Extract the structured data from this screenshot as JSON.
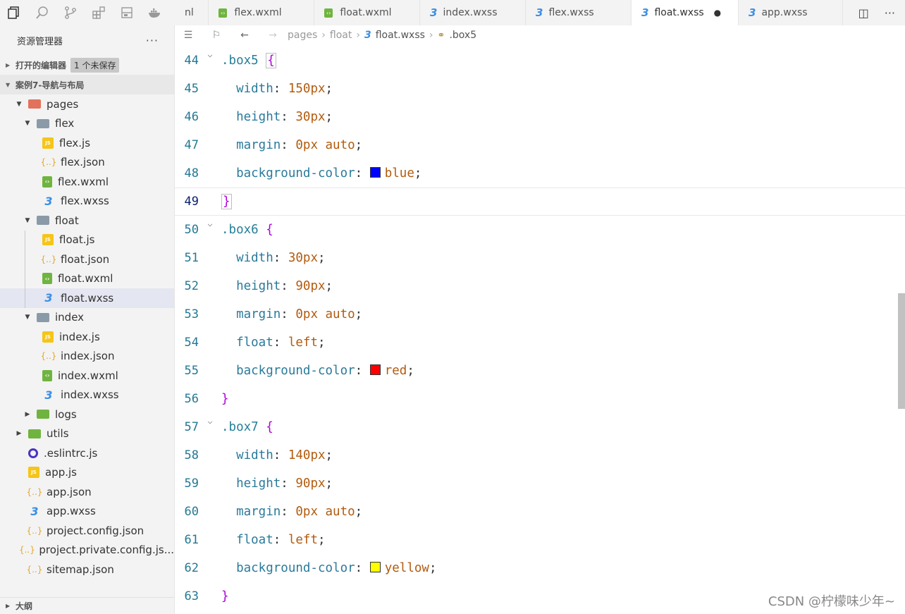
{
  "activity_bar": [
    "explorer-icon",
    "search-icon",
    "source-control-icon",
    "extensions-icon",
    "storage-icon",
    "docker-icon"
  ],
  "sidebar": {
    "title": "资源管理器",
    "more": "···",
    "open_editors": {
      "label": "打开的编辑器",
      "badge": "1 个未保存"
    },
    "project": {
      "label": "案例7-导航与布局"
    },
    "tree": [
      {
        "label": "pages",
        "type": "folder-pages",
        "depth": 1,
        "expanded": true
      },
      {
        "label": "flex",
        "type": "folder",
        "depth": 2,
        "expanded": true
      },
      {
        "label": "flex.js",
        "type": "js",
        "depth": 3
      },
      {
        "label": "flex.json",
        "type": "json",
        "depth": 3
      },
      {
        "label": "flex.wxml",
        "type": "wxml",
        "depth": 3
      },
      {
        "label": "flex.wxss",
        "type": "wxss",
        "depth": 3
      },
      {
        "label": "float",
        "type": "folder",
        "depth": 2,
        "expanded": true
      },
      {
        "label": "float.js",
        "type": "js",
        "depth": 3
      },
      {
        "label": "float.json",
        "type": "json",
        "depth": 3
      },
      {
        "label": "float.wxml",
        "type": "wxml",
        "depth": 3
      },
      {
        "label": "float.wxss",
        "type": "wxss",
        "depth": 3,
        "selected": true
      },
      {
        "label": "index",
        "type": "folder",
        "depth": 2,
        "expanded": true
      },
      {
        "label": "index.js",
        "type": "js",
        "depth": 3
      },
      {
        "label": "index.json",
        "type": "json",
        "depth": 3
      },
      {
        "label": "index.wxml",
        "type": "wxml",
        "depth": 3
      },
      {
        "label": "index.wxss",
        "type": "wxss",
        "depth": 3
      },
      {
        "label": "logs",
        "type": "folder-green",
        "depth": 2,
        "expanded": false
      },
      {
        "label": "utils",
        "type": "folder-green",
        "depth": 1,
        "expanded": false
      },
      {
        "label": ".eslintrc.js",
        "type": "eslint",
        "depth": 1
      },
      {
        "label": "app.js",
        "type": "js",
        "depth": 1
      },
      {
        "label": "app.json",
        "type": "json",
        "depth": 1
      },
      {
        "label": "app.wxss",
        "type": "wxss",
        "depth": 1
      },
      {
        "label": "project.config.json",
        "type": "json",
        "depth": 1
      },
      {
        "label": "project.private.config.js...",
        "type": "json",
        "depth": 1
      },
      {
        "label": "sitemap.json",
        "type": "json",
        "depth": 1
      }
    ],
    "outline": "大纲"
  },
  "tabs": [
    {
      "label": "nl",
      "type": "partial"
    },
    {
      "label": "flex.wxml",
      "type": "wxml"
    },
    {
      "label": "float.wxml",
      "type": "wxml"
    },
    {
      "label": "index.wxss",
      "type": "wxss"
    },
    {
      "label": "flex.wxss",
      "type": "wxss"
    },
    {
      "label": "float.wxss",
      "type": "wxss",
      "active": true,
      "unsaved": "●"
    },
    {
      "label": "app.wxss",
      "type": "wxss"
    }
  ],
  "breadcrumb": [
    "pages",
    "float",
    "float.wxss",
    ".box5"
  ],
  "editor": {
    "current_line": 49,
    "lines": [
      {
        "n": "44",
        "fold": true,
        "tokens": [
          [
            "sel",
            ".box5"
          ],
          [
            "punc",
            " "
          ],
          [
            "brace-box",
            "{"
          ]
        ]
      },
      {
        "n": "45",
        "tokens": [
          [
            "punc",
            "  "
          ],
          [
            "prop",
            "width"
          ],
          [
            "punc",
            ": "
          ],
          [
            "val",
            "150px"
          ],
          [
            "punc",
            ";"
          ]
        ]
      },
      {
        "n": "46",
        "tokens": [
          [
            "punc",
            "  "
          ],
          [
            "prop",
            "height"
          ],
          [
            "punc",
            ": "
          ],
          [
            "val",
            "30px"
          ],
          [
            "punc",
            ";"
          ]
        ]
      },
      {
        "n": "47",
        "tokens": [
          [
            "punc",
            "  "
          ],
          [
            "prop",
            "margin"
          ],
          [
            "punc",
            ": "
          ],
          [
            "val",
            "0px auto"
          ],
          [
            "punc",
            ";"
          ]
        ]
      },
      {
        "n": "48",
        "tokens": [
          [
            "punc",
            "  "
          ],
          [
            "prop",
            "background-color"
          ],
          [
            "punc",
            ": "
          ],
          [
            "swatch",
            "#0000ff"
          ],
          [
            "val",
            "blue"
          ],
          [
            "punc",
            ";"
          ]
        ]
      },
      {
        "n": "49",
        "tokens": [
          [
            "brace-box",
            "}"
          ]
        ]
      },
      {
        "n": "50",
        "fold": true,
        "tokens": [
          [
            "sel",
            ".box6"
          ],
          [
            "punc",
            " "
          ],
          [
            "brace",
            "{"
          ]
        ]
      },
      {
        "n": "51",
        "tokens": [
          [
            "punc",
            "  "
          ],
          [
            "prop",
            "width"
          ],
          [
            "punc",
            ": "
          ],
          [
            "val",
            "30px"
          ],
          [
            "punc",
            ";"
          ]
        ]
      },
      {
        "n": "52",
        "tokens": [
          [
            "punc",
            "  "
          ],
          [
            "prop",
            "height"
          ],
          [
            "punc",
            ": "
          ],
          [
            "val",
            "90px"
          ],
          [
            "punc",
            ";"
          ]
        ]
      },
      {
        "n": "53",
        "tokens": [
          [
            "punc",
            "  "
          ],
          [
            "prop",
            "margin"
          ],
          [
            "punc",
            ": "
          ],
          [
            "val",
            "0px auto"
          ],
          [
            "punc",
            ";"
          ]
        ]
      },
      {
        "n": "54",
        "tokens": [
          [
            "punc",
            "  "
          ],
          [
            "prop",
            "float"
          ],
          [
            "punc",
            ": "
          ],
          [
            "val",
            "left"
          ],
          [
            "punc",
            ";"
          ]
        ]
      },
      {
        "n": "55",
        "tokens": [
          [
            "punc",
            "  "
          ],
          [
            "prop",
            "background-color"
          ],
          [
            "punc",
            ": "
          ],
          [
            "swatch",
            "#ff0000"
          ],
          [
            "val",
            "red"
          ],
          [
            "punc",
            ";"
          ]
        ]
      },
      {
        "n": "56",
        "tokens": [
          [
            "brace",
            "}"
          ]
        ]
      },
      {
        "n": "57",
        "fold": true,
        "tokens": [
          [
            "sel",
            ".box7"
          ],
          [
            "punc",
            " "
          ],
          [
            "brace",
            "{"
          ]
        ]
      },
      {
        "n": "58",
        "tokens": [
          [
            "punc",
            "  "
          ],
          [
            "prop",
            "width"
          ],
          [
            "punc",
            ": "
          ],
          [
            "val",
            "140px"
          ],
          [
            "punc",
            ";"
          ]
        ]
      },
      {
        "n": "59",
        "tokens": [
          [
            "punc",
            "  "
          ],
          [
            "prop",
            "height"
          ],
          [
            "punc",
            ": "
          ],
          [
            "val",
            "90px"
          ],
          [
            "punc",
            ";"
          ]
        ]
      },
      {
        "n": "60",
        "tokens": [
          [
            "punc",
            "  "
          ],
          [
            "prop",
            "margin"
          ],
          [
            "punc",
            ": "
          ],
          [
            "val",
            "0px auto"
          ],
          [
            "punc",
            ";"
          ]
        ]
      },
      {
        "n": "61",
        "tokens": [
          [
            "punc",
            "  "
          ],
          [
            "prop",
            "float"
          ],
          [
            "punc",
            ": "
          ],
          [
            "val",
            "left"
          ],
          [
            "punc",
            ";"
          ]
        ]
      },
      {
        "n": "62",
        "tokens": [
          [
            "punc",
            "  "
          ],
          [
            "prop",
            "background-color"
          ],
          [
            "punc",
            ": "
          ],
          [
            "swatch",
            "#ffff00"
          ],
          [
            "val",
            "yellow"
          ],
          [
            "punc",
            ";"
          ]
        ]
      },
      {
        "n": "63",
        "tokens": [
          [
            "brace",
            "}"
          ]
        ]
      }
    ]
  },
  "watermark": "CSDN @柠檬味少年~"
}
